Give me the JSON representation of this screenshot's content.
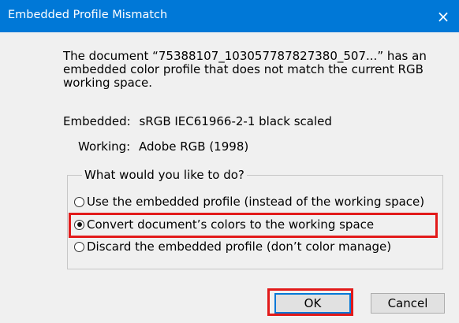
{
  "window": {
    "title": "Embedded Profile Mismatch",
    "close_icon": "×"
  },
  "message": "The document “75388107_103057787827380_507...” has an embedded color profile that does not match the current RGB working space.",
  "embedded": {
    "label": "Embedded:",
    "value": "sRGB IEC61966-2-1 black scaled"
  },
  "working": {
    "label": "Working:",
    "value": "Adobe RGB (1998)"
  },
  "options_group": {
    "legend": "What would you like to do?",
    "options": [
      {
        "label": "Use the embedded profile (instead of the working space)",
        "selected": false
      },
      {
        "label": "Convert document’s colors to the working space",
        "selected": true
      },
      {
        "label": "Discard the embedded profile (don’t color manage)",
        "selected": false
      }
    ]
  },
  "buttons": {
    "ok": "OK",
    "cancel": "Cancel"
  },
  "colors": {
    "titlebar": "#0078d7",
    "highlight": "#e21a1a",
    "background": "#f0f0f0"
  }
}
